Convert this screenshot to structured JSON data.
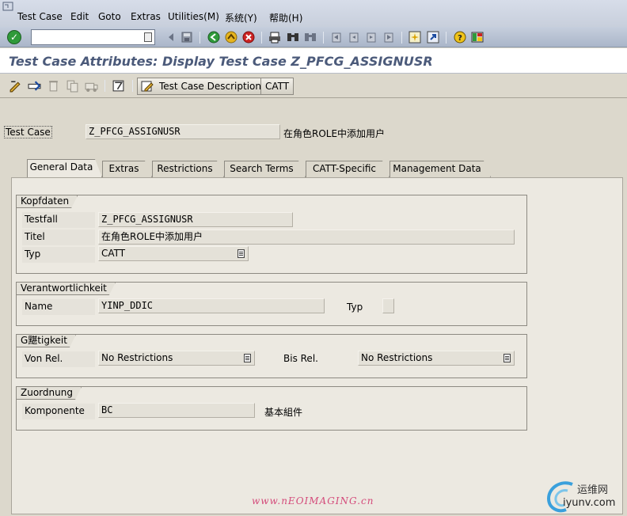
{
  "menubar": {
    "items": [
      "Test Case",
      "Edit",
      "Goto",
      "Extras",
      "Utilities(M)",
      "系统(Y)",
      "帮助(H)"
    ]
  },
  "toolbar": {
    "command_value": "",
    "icons": [
      "enter-icon",
      "back-icon",
      "save-icon",
      "green-back-icon",
      "exit-icon",
      "cancel-icon",
      "print-icon",
      "find-icon",
      "find-next-icon",
      "first-page-icon",
      "previous-page-icon",
      "next-page-icon",
      "last-page-icon",
      "create-session-icon",
      "shortcut-icon",
      "help-icon",
      "layout-icon"
    ]
  },
  "title": "Test Case Attributes: Display Test Case Z_PFCG_ASSIGNUSR",
  "app_toolbar": {
    "description_button": "Test Case Description",
    "catt_button": "CATT"
  },
  "header": {
    "test_case_label": "Test Case",
    "test_case_value": "Z_PFCG_ASSIGNUSR",
    "test_case_desc": "在角色ROLE中添加用户"
  },
  "tabs": [
    "General Data",
    "Extras",
    "Restrictions",
    "Search Terms",
    "CATT-Specific",
    "Management Data"
  ],
  "groups": {
    "kopfdaten": {
      "title": "Kopfdaten",
      "testfall_label": "Testfall",
      "testfall_value": "Z_PFCG_ASSIGNUSR",
      "titel_label": "Titel",
      "titel_value": "在角色ROLE中添加用户",
      "typ_label": "Typ",
      "typ_value": "CATT"
    },
    "verantwortlichkeit": {
      "title": "Verantwortlichkeit",
      "name_label": "Name",
      "name_value": "YINP_DDIC",
      "typ_label": "Typ",
      "typ_value": ""
    },
    "gueltigkeit": {
      "title": "G黮tigkeit",
      "von_label": "Von Rel.",
      "von_value": "No Restrictions",
      "bis_label": "Bis Rel.",
      "bis_value": "No Restrictions"
    },
    "zuordnung": {
      "title": "Zuordnung",
      "komponente_label": "Komponente",
      "komponente_value": "BC",
      "komponente_desc": "基本組件"
    }
  },
  "watermark": "www.nEOIMAGING.cn",
  "logo": {
    "text_cn": "运维网",
    "text_domain": "iyunv.com"
  },
  "colors": {
    "title_text": "#4b5a7a",
    "panel_bg": "#ece9e1",
    "ok_green": "#2f9a3a",
    "cancel_red": "#cc2222"
  }
}
